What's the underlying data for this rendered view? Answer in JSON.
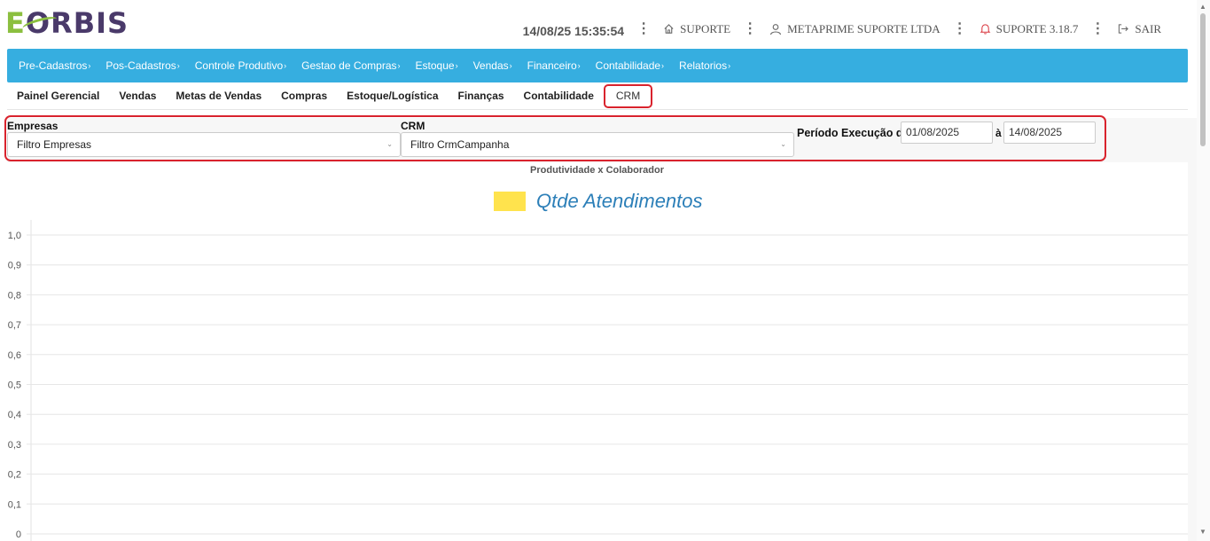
{
  "header": {
    "logo": {
      "e": "E",
      "orb": "O",
      "rest": "RBIS"
    },
    "datetime": "14/08/25 15:35:54",
    "support_label": "SUPORTE",
    "company": "METAPRIME SUPORTE LTDA",
    "notifications": "SUPORTE 3.18.7",
    "logout": "SAIR"
  },
  "menu": [
    {
      "label": "Pre-Cadastros"
    },
    {
      "label": "Pos-Cadastros"
    },
    {
      "label": "Controle Produtivo"
    },
    {
      "label": "Gestao de Compras"
    },
    {
      "label": "Estoque"
    },
    {
      "label": "Vendas"
    },
    {
      "label": "Financeiro"
    },
    {
      "label": "Contabilidade"
    },
    {
      "label": "Relatorios"
    }
  ],
  "tabs": [
    {
      "label": "Painel Gerencial"
    },
    {
      "label": "Vendas"
    },
    {
      "label": "Metas de Vendas"
    },
    {
      "label": "Compras"
    },
    {
      "label": "Estoque/Logística"
    },
    {
      "label": "Finanças"
    },
    {
      "label": "Contabilidade"
    },
    {
      "label": "CRM",
      "active": true
    }
  ],
  "filters": {
    "empresas_label": "Empresas",
    "empresas_value": "Filtro Empresas",
    "crm_label": "CRM",
    "crm_value": "Filtro CrmCampanha",
    "periodo_label": "Período Execução de",
    "date_from": "01/08/2025",
    "date_sep": "à",
    "date_to": "14/08/2025"
  },
  "chart_data": {
    "type": "bar",
    "title": "Produtividade x Colaborador",
    "series": [
      {
        "name": "Qtde Atendimentos",
        "color": "#ffe34d",
        "values": []
      }
    ],
    "categories": [],
    "ylim": [
      0,
      1.0
    ],
    "yticks": [
      "1,0",
      "0,9",
      "0,8",
      "0,7",
      "0,6",
      "0,5",
      "0,4",
      "0,3",
      "0,2",
      "0,1",
      "0"
    ],
    "grid": true,
    "legend_position": "top"
  },
  "icons": {
    "support": "home-icon",
    "company": "user-icon",
    "notifications": "bell-icon",
    "logout": "logout-icon"
  }
}
